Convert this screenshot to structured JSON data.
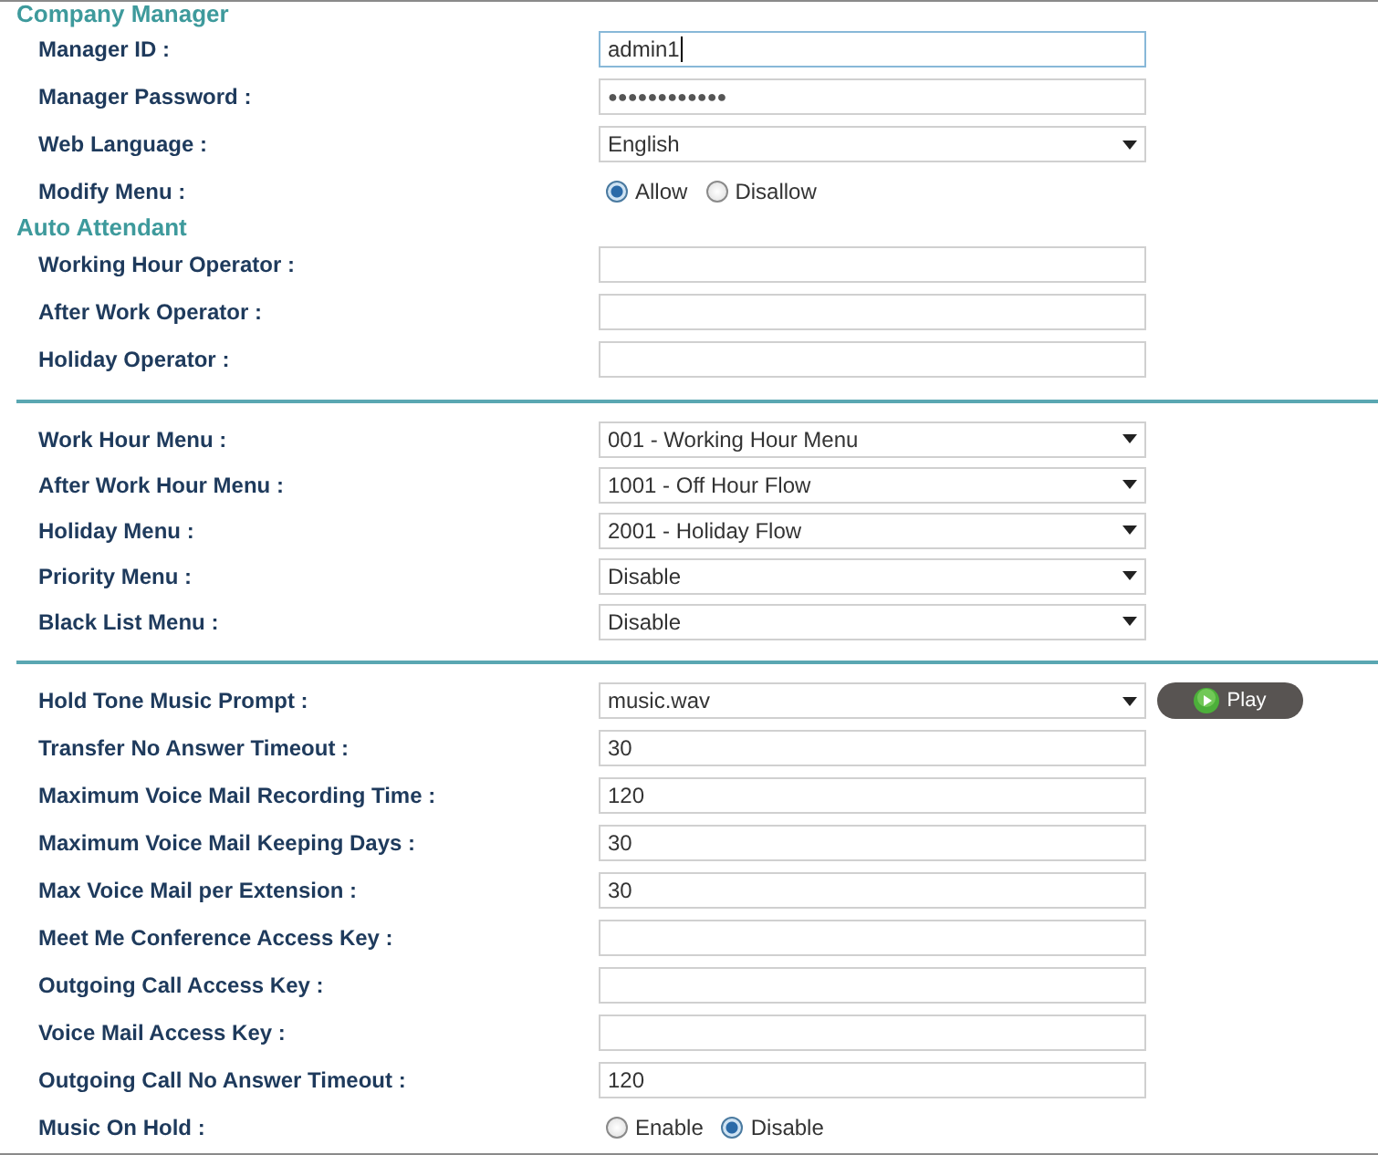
{
  "blocks": [
    {
      "kind": "heading",
      "text": "Company Manager"
    },
    {
      "kind": "row",
      "label": "Manager ID :",
      "field": {
        "kind": "text",
        "value": "admin1",
        "focused": true
      }
    },
    {
      "kind": "row",
      "label": "Manager Password :",
      "field": {
        "kind": "password",
        "value": "●●●●●●●●●●●●"
      }
    },
    {
      "kind": "row",
      "label": "Web Language :",
      "field": {
        "kind": "select",
        "value": "English"
      }
    },
    {
      "kind": "row",
      "label": "Modify Menu :",
      "field": {
        "kind": "radio",
        "options": [
          {
            "label": "Allow",
            "selected": true
          },
          {
            "label": "Disallow",
            "selected": false
          }
        ]
      }
    },
    {
      "kind": "heading",
      "text": "Auto Attendant"
    },
    {
      "kind": "row",
      "label": "Working Hour Operator :",
      "field": {
        "kind": "text"
      }
    },
    {
      "kind": "row",
      "label": "After Work Operator :",
      "field": {
        "kind": "text"
      }
    },
    {
      "kind": "row",
      "label": "Holiday Operator :",
      "field": {
        "kind": "text"
      }
    },
    {
      "kind": "divider"
    },
    {
      "kind": "row",
      "label": "Work Hour Menu :",
      "field": {
        "kind": "select",
        "value": "001 - Working Hour Menu"
      }
    },
    {
      "kind": "row",
      "label": "After Work Hour Menu :",
      "field": {
        "kind": "select",
        "value": "1001 - Off Hour Flow"
      }
    },
    {
      "kind": "row",
      "label": "Holiday Menu :",
      "field": {
        "kind": "select",
        "value": "2001 - Holiday Flow"
      }
    },
    {
      "kind": "row",
      "label": "Priority Menu :",
      "field": {
        "kind": "select",
        "value": "Disable"
      }
    },
    {
      "kind": "row",
      "label": "Black List Menu :",
      "field": {
        "kind": "select",
        "value": "Disable"
      }
    },
    {
      "kind": "divider"
    },
    {
      "kind": "row",
      "label": "Hold Tone Music Prompt :",
      "field": {
        "kind": "select",
        "value": "music.wav"
      },
      "button": "Play"
    },
    {
      "kind": "row",
      "label": "Transfer No Answer Timeout :",
      "field": {
        "kind": "text",
        "value": "30"
      }
    },
    {
      "kind": "row",
      "label": "Maximum Voice Mail Recording Time :",
      "field": {
        "kind": "text",
        "value": "120"
      }
    },
    {
      "kind": "row",
      "label": "Maximum Voice Mail Keeping Days :",
      "field": {
        "kind": "text",
        "value": "30"
      }
    },
    {
      "kind": "row",
      "label": "Max Voice Mail per Extension :",
      "field": {
        "kind": "text",
        "value": "30"
      }
    },
    {
      "kind": "row",
      "label": "Meet Me Conference Access Key :",
      "field": {
        "kind": "text"
      }
    },
    {
      "kind": "row",
      "label": "Outgoing Call Access Key :",
      "field": {
        "kind": "text"
      }
    },
    {
      "kind": "row",
      "label": "Voice Mail Access Key :",
      "field": {
        "kind": "text"
      }
    },
    {
      "kind": "row",
      "label": "Outgoing Call No Answer Timeout :",
      "field": {
        "kind": "text",
        "value": "120"
      }
    },
    {
      "kind": "row",
      "label": "Music On Hold :",
      "field": {
        "kind": "radio",
        "options": [
          {
            "label": "Enable",
            "selected": false
          },
          {
            "label": "Disable",
            "selected": true
          }
        ]
      }
    }
  ]
}
